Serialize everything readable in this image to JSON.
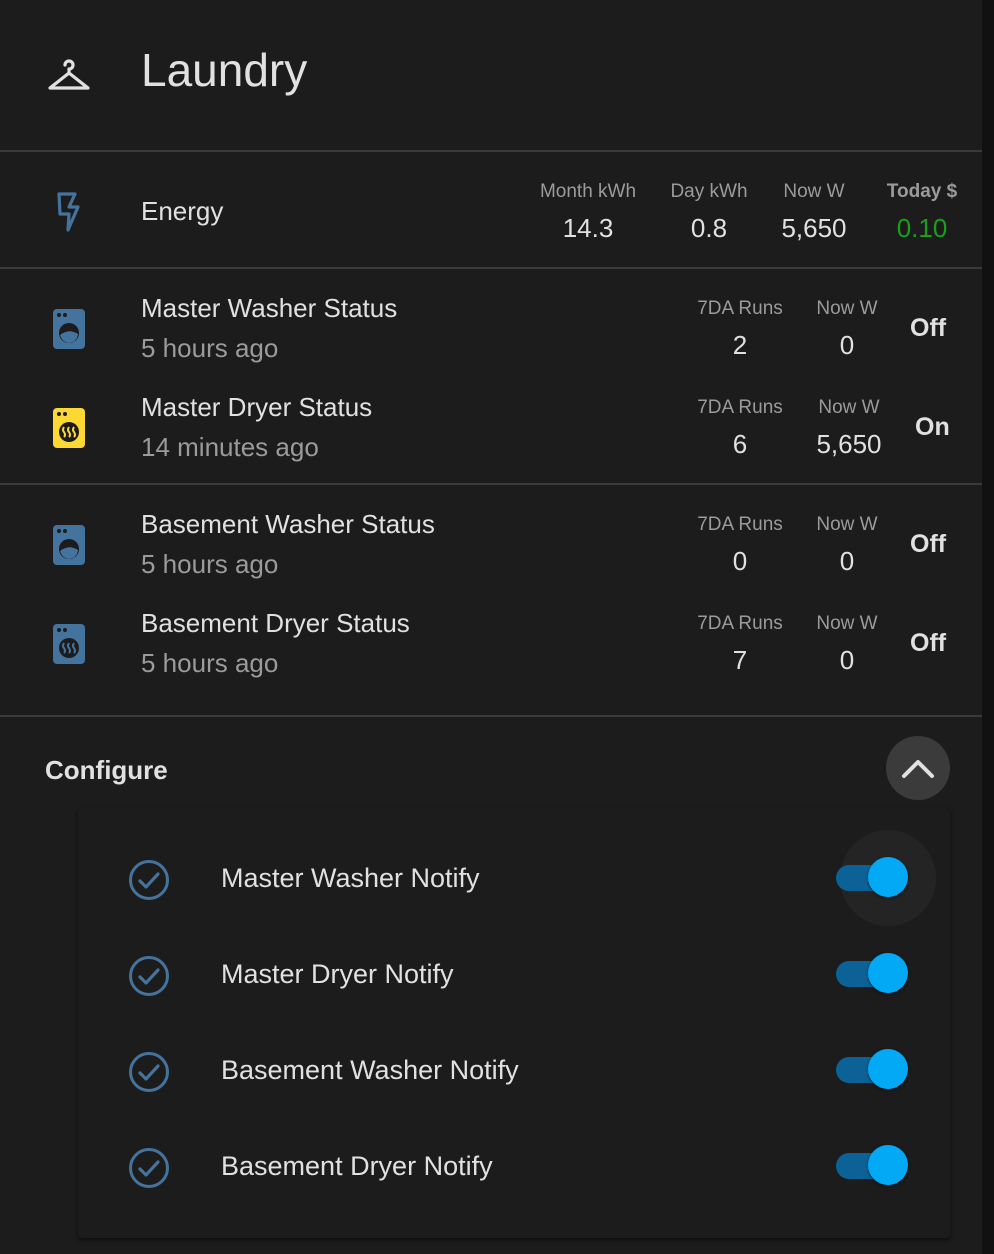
{
  "header": {
    "title": "Laundry",
    "icon": "hanger-icon"
  },
  "energy": {
    "name": "Energy",
    "icon": "lightning-bolt-icon",
    "attributes": [
      {
        "label": "Month kWh",
        "value": "14.3"
      },
      {
        "label": "Day kWh",
        "value": "0.8"
      },
      {
        "label": "Now W",
        "value": "5,650"
      },
      {
        "label": "Today $",
        "value": "0.10",
        "color": "#1a9f1a"
      }
    ]
  },
  "devices": [
    {
      "name": "Master Washer Status",
      "last_changed": "5 hours ago",
      "icon": "washing-machine-icon",
      "icon_color": "#44739e",
      "runs_label": "7DA Runs",
      "runs": "2",
      "now_label": "Now W",
      "now": "0",
      "state": "Off"
    },
    {
      "name": "Master Dryer Status",
      "last_changed": "14 minutes ago",
      "icon": "tumble-dryer-icon",
      "icon_color": "#fdd835",
      "runs_label": "7DA Runs",
      "runs": "6",
      "now_label": "Now W",
      "now": "5,650",
      "state": "On"
    },
    {
      "name": "Basement Washer Status",
      "last_changed": "5 hours ago",
      "icon": "washing-machine-icon",
      "icon_color": "#44739e",
      "runs_label": "7DA Runs",
      "runs": "0",
      "now_label": "Now W",
      "now": "0",
      "state": "Off"
    },
    {
      "name": "Basement Dryer Status",
      "last_changed": "5 hours ago",
      "icon": "tumble-dryer-icon",
      "icon_color": "#44739e",
      "runs_label": "7DA Runs",
      "runs": "7",
      "now_label": "Now W",
      "now": "0",
      "state": "Off"
    }
  ],
  "configure": {
    "title": "Configure",
    "collapse_icon": "chevron-up-icon",
    "items": [
      {
        "label": "Master Washer Notify",
        "enabled": true,
        "icon": "check-circle-outline-icon"
      },
      {
        "label": "Master Dryer Notify",
        "enabled": true,
        "icon": "check-circle-outline-icon"
      },
      {
        "label": "Basement Washer Notify",
        "enabled": true,
        "icon": "check-circle-outline-icon"
      },
      {
        "label": "Basement Dryer Notify",
        "enabled": true,
        "icon": "check-circle-outline-icon"
      }
    ]
  },
  "colors": {
    "accent": "#03a9f4",
    "icon_default": "#44739e",
    "icon_active": "#fdd835",
    "cost_green": "#1a9f1a"
  }
}
